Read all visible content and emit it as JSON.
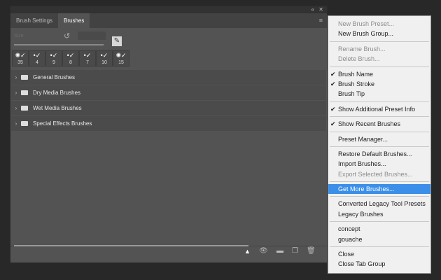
{
  "panel": {
    "tabs": [
      "Brush Settings",
      "Brushes"
    ],
    "size_label": "Size",
    "presets": [
      "35",
      "4",
      "9",
      "8",
      "7",
      "10",
      "15"
    ],
    "groups": [
      "General Brushes",
      "Dry Media Brushes",
      "Wet Media Brushes",
      "Special Effects Brushes"
    ]
  },
  "menu": {
    "sections": [
      [
        {
          "label": "New Brush Preset...",
          "disabled": true
        },
        {
          "label": "New Brush Group..."
        }
      ],
      [
        {
          "label": "Rename Brush...",
          "disabled": true
        },
        {
          "label": "Delete Brush...",
          "disabled": true
        }
      ],
      [
        {
          "label": "Brush Name",
          "checked": true
        },
        {
          "label": "Brush Stroke",
          "checked": true
        },
        {
          "label": "Brush Tip"
        }
      ],
      [
        {
          "label": "Show Additional Preset Info",
          "checked": true
        }
      ],
      [
        {
          "label": "Show Recent Brushes",
          "checked": true
        }
      ],
      [
        {
          "label": "Preset Manager..."
        }
      ],
      [
        {
          "label": "Restore Default Brushes..."
        },
        {
          "label": "Import Brushes..."
        },
        {
          "label": "Export Selected Brushes...",
          "disabled": true
        }
      ],
      [
        {
          "label": "Get More Brushes...",
          "highlighted": true
        }
      ],
      [
        {
          "label": "Converted Legacy Tool Presets"
        },
        {
          "label": "Legacy Brushes"
        }
      ],
      [
        {
          "label": "concept"
        },
        {
          "label": "gouache"
        }
      ],
      [
        {
          "label": "Close"
        },
        {
          "label": "Close Tab Group"
        }
      ]
    ]
  },
  "colors": {
    "highlight": "#3b8fe8",
    "panel": "#535353",
    "menu": "#f0f0f0"
  }
}
